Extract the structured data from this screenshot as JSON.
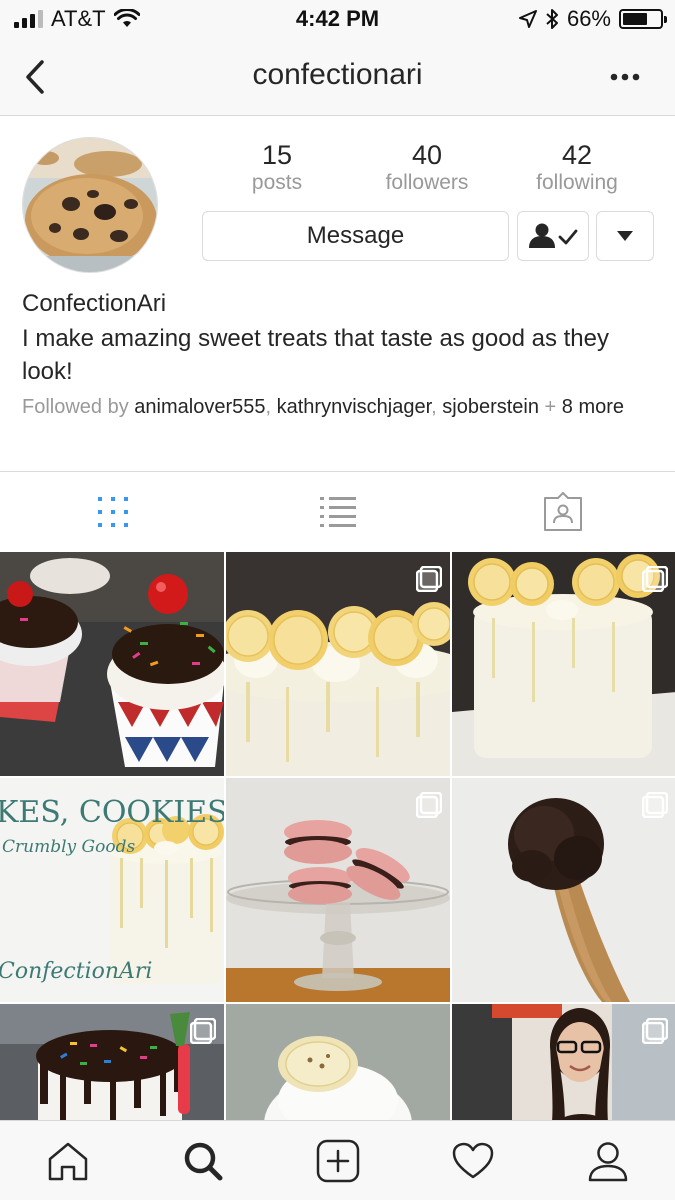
{
  "status_bar": {
    "carrier": "AT&T",
    "time": "4:42 PM",
    "battery": "66%",
    "battery_level": 0.66
  },
  "header": {
    "title": "confectionari"
  },
  "profile": {
    "stats": [
      {
        "value": "15",
        "label": "posts"
      },
      {
        "value": "40",
        "label": "followers"
      },
      {
        "value": "42",
        "label": "following"
      }
    ],
    "message_label": "Message",
    "name": "ConfectionAri",
    "bio": "I make amazing sweet treats that taste as good as they look!",
    "followed_by_prefix": "Followed by",
    "followed_by": [
      "animalover555",
      "kathrynvischjager",
      "sjoberstein"
    ],
    "followed_more": "8 more"
  },
  "grid": {
    "cells": [
      {
        "name": "post-cupcakes",
        "multi": false
      },
      {
        "name": "post-lemon-cake",
        "multi": true
      },
      {
        "name": "post-lemon-cake-2",
        "multi": true
      },
      {
        "name": "post-confectionari-cake",
        "multi": false
      },
      {
        "name": "post-macarons",
        "multi": true
      },
      {
        "name": "post-chocolate-spoon",
        "multi": true
      },
      {
        "name": "post-sprinkle-cake",
        "multi": true
      },
      {
        "name": "post-banana-cupcake",
        "multi": false
      },
      {
        "name": "post-portrait",
        "multi": true
      }
    ],
    "overlay_text": {
      "cookies": "KES, COOKIES",
      "crumbly": "Crumbly Goods",
      "brand": "ConfectionAri"
    }
  },
  "colors": {
    "accent": "#3897f0",
    "text": "#262626",
    "muted": "#999999",
    "border": "#dbdbdb"
  },
  "icons": {
    "back": "chevron-left-icon",
    "more": "more-horizontal-icon",
    "grid_tab": "grid-icon",
    "list_tab": "list-icon",
    "tagged_tab": "tagged-icon",
    "home": "home-icon",
    "search": "search-icon",
    "add": "add-post-icon",
    "activity": "heart-icon",
    "profile": "profile-icon"
  }
}
